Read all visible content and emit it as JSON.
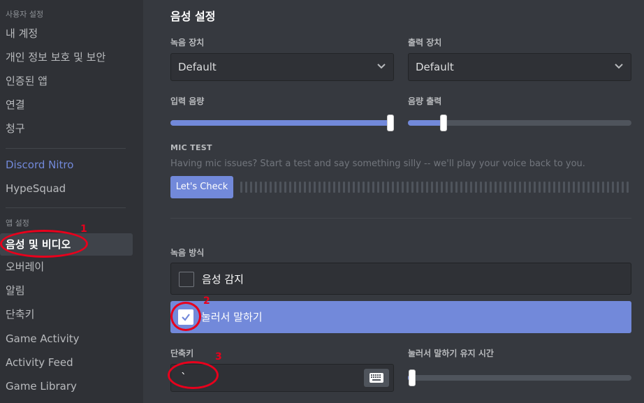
{
  "sidebar": {
    "user_settings_header": "사용자 설정",
    "user_items": [
      "내 계정",
      "개인 정보 보호 및 보안",
      "인증된 앱",
      "연결",
      "청구"
    ],
    "nitro": "Discord Nitro",
    "hypesquad": "HypeSquad",
    "app_settings_header": "앱 설정",
    "app_items": [
      "음성 및 비디오",
      "오버레이",
      "알림",
      "단축키",
      "Game Activity",
      "Activity Feed",
      "Game Library"
    ],
    "selected_item": "음성 및 비디오"
  },
  "main": {
    "title": "음성 설정",
    "input_device_label": "녹음 장치",
    "input_device_value": "Default",
    "output_device_label": "출력 장치",
    "output_device_value": "Default",
    "input_volume_label": "입력 음량",
    "input_volume": 1.0,
    "output_volume_label": "음량 출력",
    "output_volume": 0.16,
    "mic_test_title": "MIC TEST",
    "mic_test_desc": "Having mic issues? Start a test and say something silly -- we'll play your voice back to you.",
    "mic_test_button": "Let's Check",
    "input_mode_label": "녹음 방식",
    "input_modes": [
      "음성 감지",
      "눌러서 말하기"
    ],
    "selected_input_mode": "눌러서 말하기",
    "shortcut_label": "단축키",
    "shortcut_value": "`",
    "ptt_delay_label": "눌러서 말하기 유지 시간",
    "ptt_delay": 0.02
  },
  "annotations": [
    "1",
    "2",
    "3"
  ],
  "colors": {
    "accent": "#7289da",
    "annotation": "#e8001c",
    "background": "#36393f",
    "sidebar": "#2f3136"
  }
}
